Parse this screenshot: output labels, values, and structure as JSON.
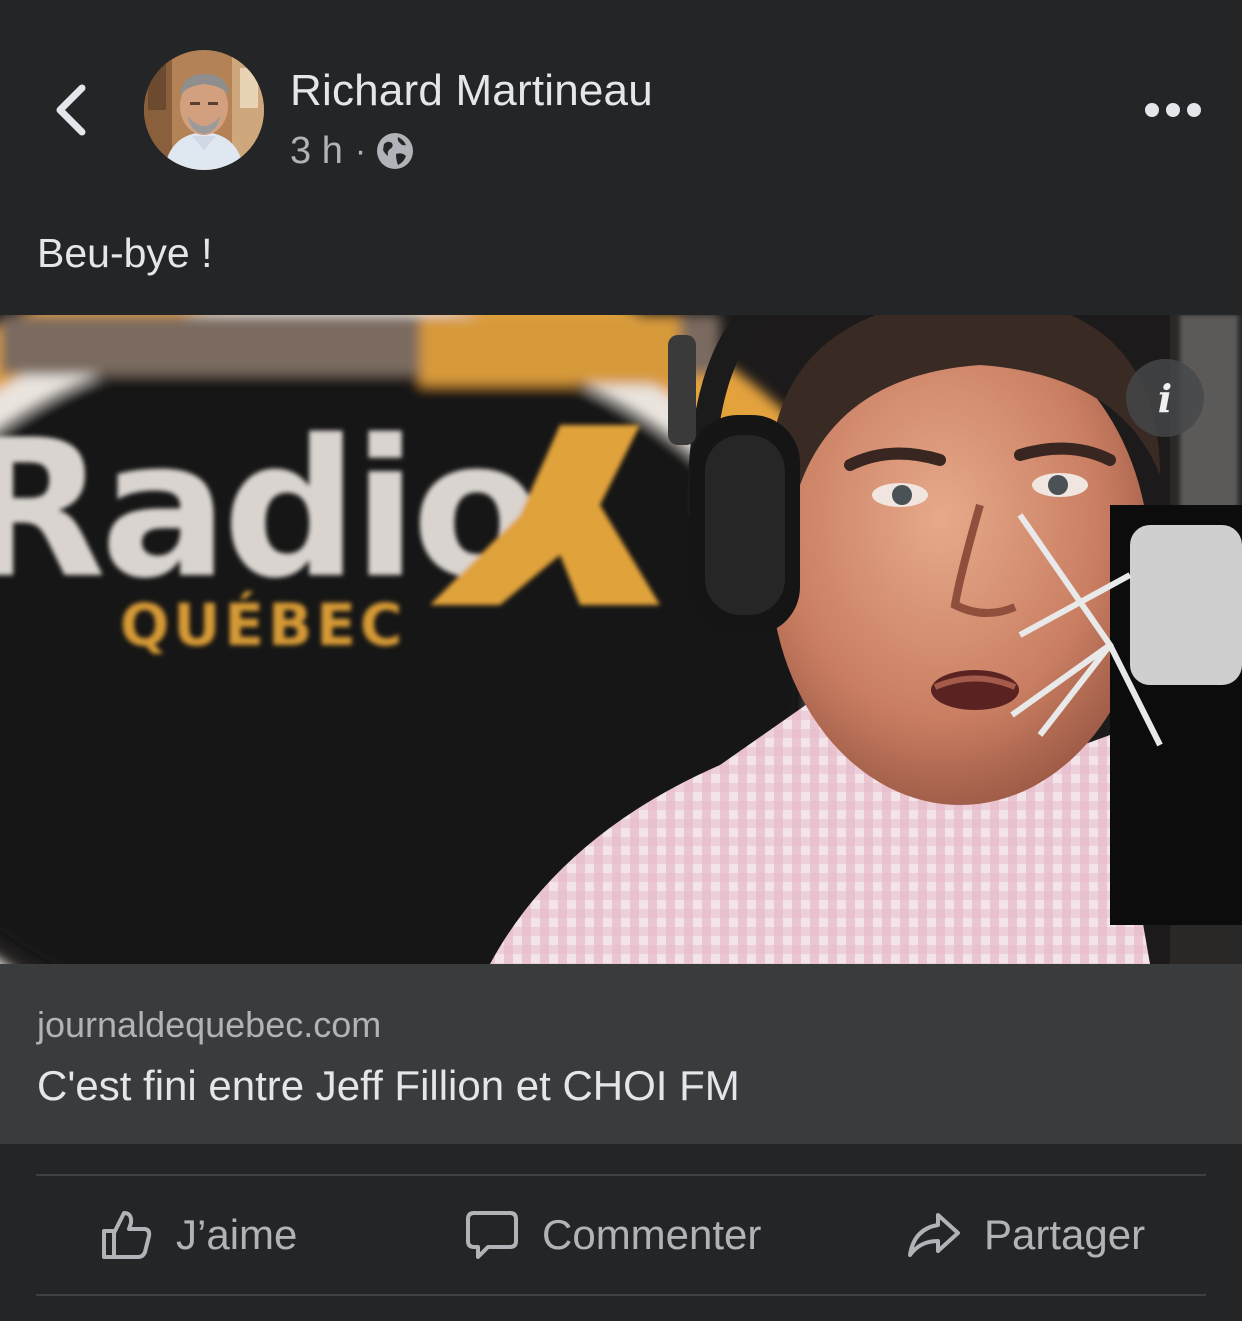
{
  "post": {
    "author": "Richard Martineau",
    "time": "3 h",
    "separator": "·",
    "audience_icon": "globe-icon",
    "text": "Beu-bye !"
  },
  "link": {
    "domain": "journaldequebec.com",
    "title": "C'est fini entre Jeff Fillion et CHOI FM",
    "image_logo_lines": [
      "Radio X",
      "QUÉBEC"
    ],
    "info_glyph": "i"
  },
  "actions": {
    "like": "J’aime",
    "comment": "Commenter",
    "share": "Partager"
  },
  "icons": {
    "back": "chevron-left-icon",
    "more": "more-horizontal-icon",
    "like": "thumbs-up-icon",
    "comment": "comment-bubble-icon",
    "share": "share-arrow-icon"
  },
  "colors": {
    "background": "#242526",
    "card_caption": "#3a3b3c",
    "primary_text": "#e4e6eb",
    "secondary_text": "#b0b3b8",
    "brand_orange": "#e8a53a"
  }
}
